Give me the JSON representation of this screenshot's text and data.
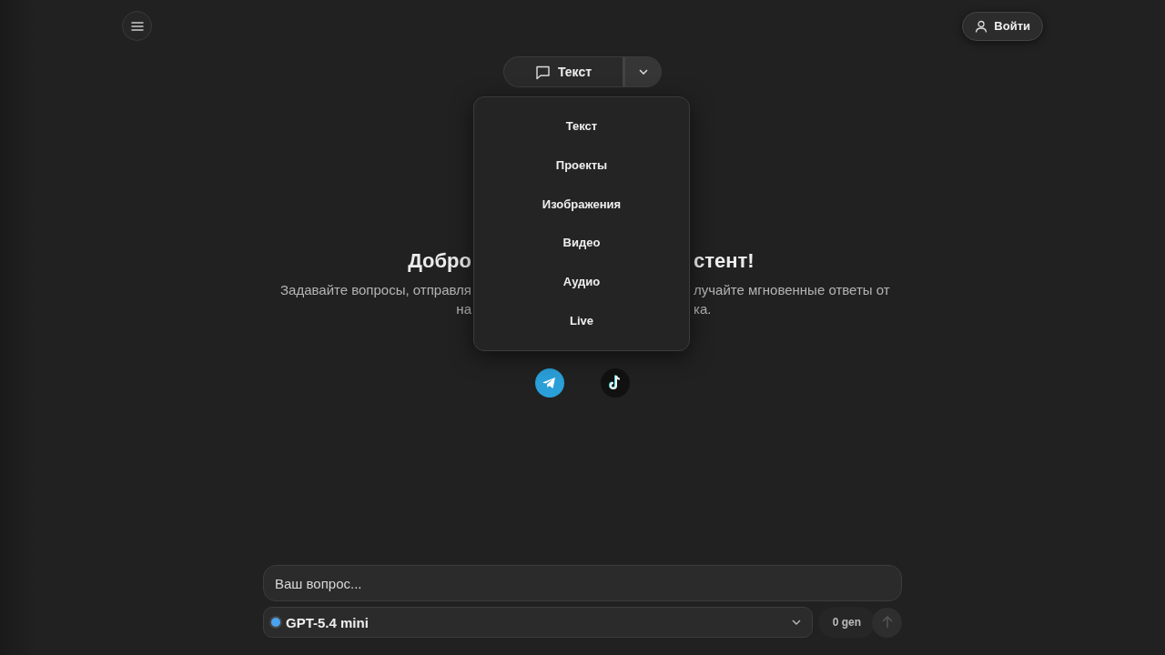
{
  "header": {
    "login_button": "Войти"
  },
  "mode_selector": {
    "label": "Текст",
    "expanded": true,
    "options": [
      {
        "label": "Текст"
      },
      {
        "label": "Проекты"
      },
      {
        "label": "Изображения"
      },
      {
        "label": "Видео"
      },
      {
        "label": "Аудио"
      },
      {
        "label": "Live"
      }
    ]
  },
  "welcome": {
    "title": {
      "left": "Добро",
      "right": "стент!"
    },
    "subtitle": [
      {
        "left": "Задавайте вопросы, отправля",
        "right": "лучайте мгновенные ответы от"
      },
      {
        "left": "на",
        "right": "ка."
      }
    ]
  },
  "social": [
    {
      "kind": "telegram"
    },
    {
      "kind": "tiktok"
    }
  ],
  "composer": {
    "placeholder": "Ваш вопрос...",
    "model": {
      "name": "GPT-5.4 mini",
      "color": "#4aa3f0"
    },
    "credits": "0 gen"
  }
}
